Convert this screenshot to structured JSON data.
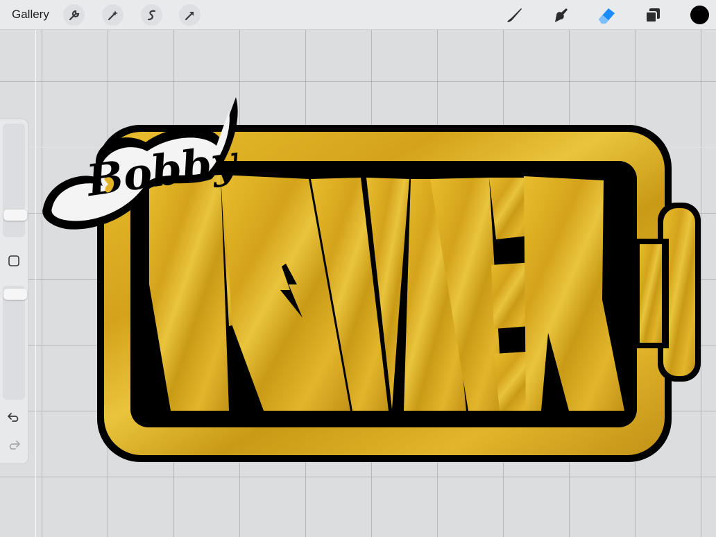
{
  "toolbar": {
    "gallery_label": "Gallery",
    "left_tools": [
      "wrench-icon",
      "magic-wand-icon",
      "selection-icon",
      "transform-arrow-icon"
    ],
    "right_tools": [
      "brush-icon",
      "smudge-icon",
      "eraser-icon",
      "layers-icon"
    ],
    "active_tool": "eraser-icon",
    "active_color": "#000000",
    "accent_color": "#1a8cff"
  },
  "sidebar": {
    "brush_size_level": 0.8,
    "opacity_level": 0.05,
    "modify_button": "square-icon",
    "undo": "undo-icon",
    "redo": "redo-icon"
  },
  "artwork": {
    "script_word": "Bobby",
    "main_word_letters": [
      "P",
      "W",
      "E",
      "R"
    ],
    "fill_color": "#d8a81e",
    "outline_color": "#000000"
  }
}
